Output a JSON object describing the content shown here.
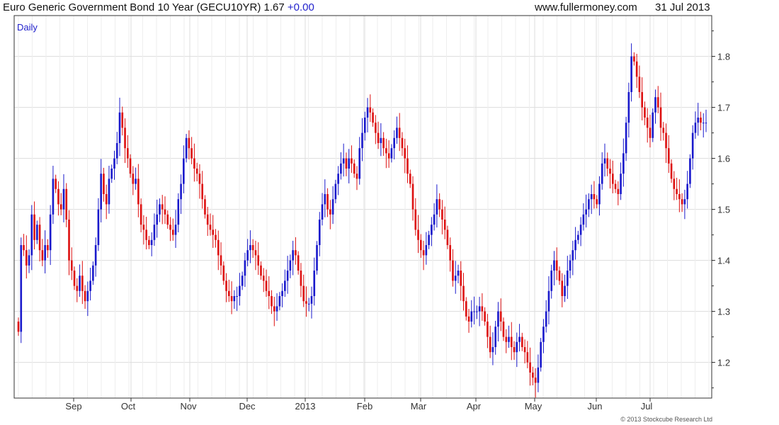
{
  "header": {
    "title": "Euro Generic Government Bond 10 Year (GECU10YR) 1.67",
    "change": "+0.00",
    "site": "www.fullermoney.com",
    "date": "31 Jul 2013"
  },
  "footer": {
    "copyright": "© 2013 Stockcube Research Ltd"
  },
  "colors": {
    "up": "#1a1acc",
    "down": "#dd1111",
    "grid": "#dddddd",
    "axis": "#333333",
    "label": "#333333"
  },
  "chart_data": {
    "type": "candlestick",
    "title": "Euro Generic Government Bond 10 Year (GECU10YR) 1.67 +0.00",
    "period_label": "Daily",
    "ylim": [
      1.13,
      1.88
    ],
    "y_ticks": [
      "1.2",
      "1.3",
      "1.4",
      "1.5",
      "1.6",
      "1.7",
      "1.8"
    ],
    "x_ticks": [
      "Sep",
      "Oct",
      "Nov",
      "Dec",
      "2013",
      "Feb",
      "Mar",
      "Apr",
      "May",
      "Jun",
      "Jul"
    ],
    "grid": true,
    "series": [
      {
        "name": "GECU10YR",
        "close": [
          1.26,
          1.43,
          1.42,
          1.39,
          1.41,
          1.49,
          1.44,
          1.47,
          1.42,
          1.4,
          1.43,
          1.42,
          1.49,
          1.56,
          1.54,
          1.51,
          1.5,
          1.54,
          1.48,
          1.4,
          1.38,
          1.35,
          1.34,
          1.37,
          1.34,
          1.32,
          1.34,
          1.36,
          1.39,
          1.43,
          1.5,
          1.57,
          1.53,
          1.51,
          1.56,
          1.58,
          1.6,
          1.63,
          1.69,
          1.66,
          1.62,
          1.6,
          1.57,
          1.55,
          1.56,
          1.51,
          1.47,
          1.46,
          1.44,
          1.43,
          1.44,
          1.47,
          1.49,
          1.51,
          1.5,
          1.49,
          1.47,
          1.46,
          1.45,
          1.47,
          1.52,
          1.55,
          1.6,
          1.64,
          1.62,
          1.6,
          1.58,
          1.57,
          1.55,
          1.52,
          1.49,
          1.47,
          1.46,
          1.45,
          1.44,
          1.41,
          1.39,
          1.36,
          1.34,
          1.33,
          1.32,
          1.33,
          1.33,
          1.35,
          1.37,
          1.4,
          1.42,
          1.43,
          1.42,
          1.41,
          1.39,
          1.37,
          1.36,
          1.34,
          1.33,
          1.31,
          1.3,
          1.31,
          1.33,
          1.34,
          1.36,
          1.38,
          1.4,
          1.42,
          1.41,
          1.38,
          1.35,
          1.32,
          1.315,
          1.315,
          1.33,
          1.38,
          1.43,
          1.48,
          1.51,
          1.53,
          1.5,
          1.49,
          1.52,
          1.55,
          1.57,
          1.59,
          1.6,
          1.58,
          1.6,
          1.59,
          1.57,
          1.56,
          1.62,
          1.65,
          1.68,
          1.7,
          1.69,
          1.67,
          1.65,
          1.63,
          1.64,
          1.62,
          1.61,
          1.6,
          1.62,
          1.64,
          1.66,
          1.64,
          1.62,
          1.6,
          1.57,
          1.55,
          1.5,
          1.46,
          1.44,
          1.42,
          1.41,
          1.43,
          1.45,
          1.47,
          1.49,
          1.52,
          1.5,
          1.48,
          1.46,
          1.43,
          1.4,
          1.36,
          1.37,
          1.38,
          1.35,
          1.32,
          1.29,
          1.28,
          1.3,
          1.3,
          1.3,
          1.31,
          1.3,
          1.28,
          1.25,
          1.22,
          1.23,
          1.27,
          1.3,
          1.28,
          1.25,
          1.24,
          1.25,
          1.23,
          1.22,
          1.24,
          1.25,
          1.23,
          1.22,
          1.2,
          1.18,
          1.17,
          1.16,
          1.19,
          1.24,
          1.27,
          1.3,
          1.34,
          1.38,
          1.4,
          1.38,
          1.36,
          1.33,
          1.35,
          1.38,
          1.4,
          1.42,
          1.44,
          1.45,
          1.47,
          1.49,
          1.5,
          1.52,
          1.53,
          1.52,
          1.51,
          1.55,
          1.59,
          1.6,
          1.58,
          1.57,
          1.55,
          1.54,
          1.53,
          1.57,
          1.61,
          1.67,
          1.73,
          1.8,
          1.79,
          1.76,
          1.73,
          1.7,
          1.68,
          1.66,
          1.64,
          1.69,
          1.72,
          1.7,
          1.66,
          1.65,
          1.62,
          1.59,
          1.56,
          1.54,
          1.53,
          1.52,
          1.51,
          1.52,
          1.55,
          1.6,
          1.65,
          1.67,
          1.68,
          1.67,
          1.67,
          1.67
        ]
      }
    ]
  }
}
